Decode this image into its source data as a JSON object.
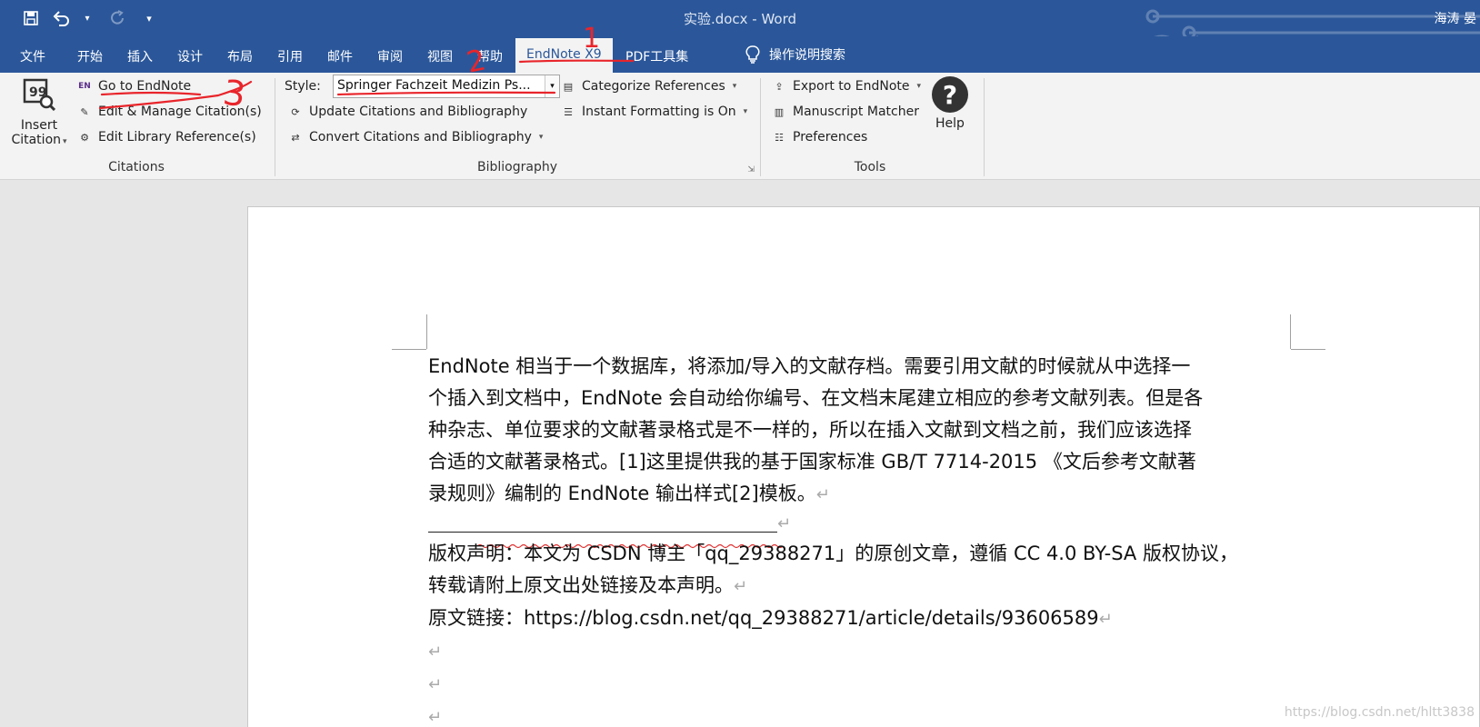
{
  "titlebar": {
    "doc_title": "实验.docx  -  Word",
    "user": "海涛 晏",
    "qat": {
      "save_icon": "save-icon",
      "undo_icon": "undo-icon",
      "redo_icon": "redo-icon",
      "customize_icon": "customize-qat-icon"
    }
  },
  "tabs": {
    "items": [
      "文件",
      "开始",
      "插入",
      "设计",
      "布局",
      "引用",
      "邮件",
      "审阅",
      "视图",
      "帮助",
      "EndNote X9",
      "PDF工具集"
    ],
    "search": "操作说明搜索"
  },
  "ribbon": {
    "citations": {
      "label": "Citations",
      "insert_citation_line1": "Insert",
      "insert_citation_line2": "Citation",
      "go_to_endnote": "Go to EndNote",
      "edit_manage": "Edit & Manage Citation(s)",
      "edit_library": "Edit Library Reference(s)"
    },
    "bibliography": {
      "label": "Bibliography",
      "style_label": "Style:",
      "style_value": "Springer Fachzeit Medizin Ps...",
      "update": "Update Citations and Bibliography",
      "convert": "Convert Citations and Bibliography",
      "categorize": "Categorize References",
      "instant": "Instant Formatting is On"
    },
    "tools": {
      "label": "Tools",
      "export": "Export to EndNote",
      "manuscript": "Manuscript Matcher",
      "preferences": "Preferences",
      "help": "Help"
    }
  },
  "document": {
    "para1_lines": [
      "EndNote  相当于一个数据库，将添加/导入的文献存档。需要引用文献的时候就从中选择一",
      "个插入到文档中，EndNote  会自动给你编号、在文档末尾建立相应的参考文献列表。但是各",
      "种杂志、单位要求的文献著录格式是不一样的，所以在插入文献到文档之前，我们应该选择",
      "合适的文献著录格式。[1]这里提供我的基于国家标准  GB/T  7714-2015  《文后参考文献著",
      "录规则》编制的  EndNote  输出样式[2]模板。"
    ],
    "return_mark": "↵",
    "copyright_line1": "版权声明：本文为 CSDN 博主「qq_29388271」的原创文章，遵循 CC 4.0 BY-SA 版权协议，",
    "copyright_line2": "转载请附上原文出处链接及本声明。",
    "source_line": "原文链接：https://blog.csdn.net/qq_29388271/article/details/93606589"
  },
  "watermark": "https://blog.csdn.net/hltt3838",
  "annotations": {
    "mark1": "1",
    "mark2": "2",
    "mark3": "3",
    "color": "#e8252b"
  },
  "colors": {
    "word_blue": "#2b579a",
    "ribbon_bg": "#f3f3f3",
    "page_bg": "#ffffff"
  }
}
